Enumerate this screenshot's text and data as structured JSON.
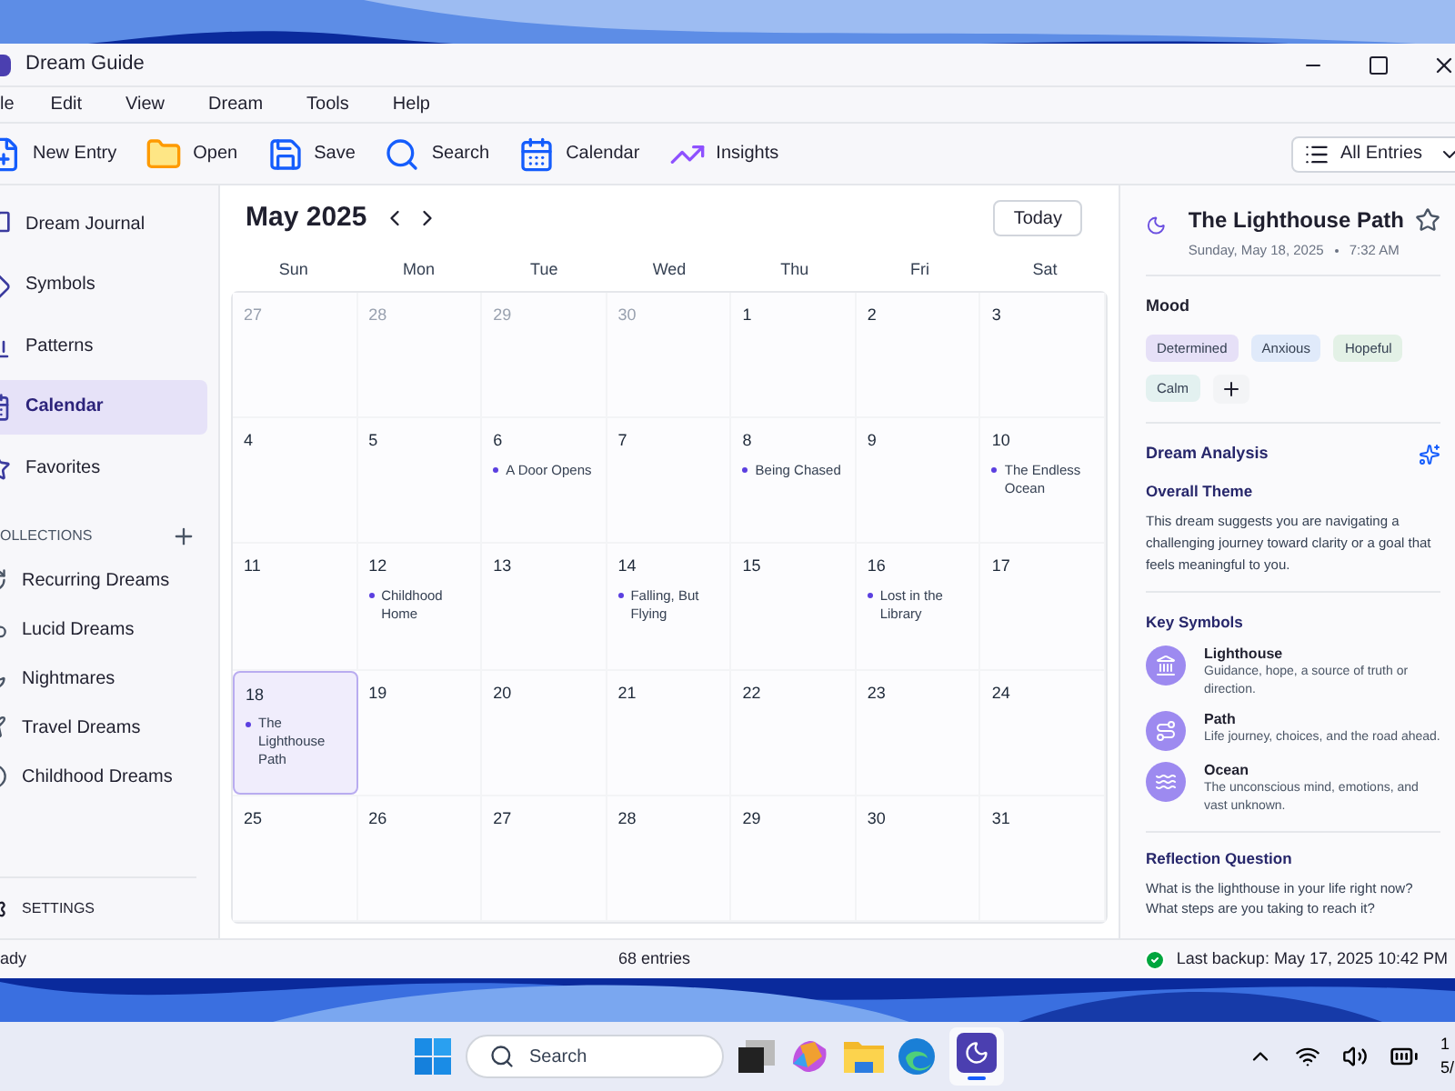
{
  "window": {
    "title": "Dream Guide"
  },
  "menu": [
    "le",
    "Edit",
    "View",
    "Dream",
    "Tools",
    "Help"
  ],
  "toolbar": [
    "New Entry",
    "Open",
    "Save",
    "Search",
    "Calendar",
    "Insights"
  ],
  "filter": {
    "value": "All Entries"
  },
  "sidebar": {
    "items": [
      {
        "label": "Dream Journal",
        "selected": false
      },
      {
        "label": "Symbols",
        "selected": false
      },
      {
        "label": "Patterns",
        "selected": false
      },
      {
        "label": "Calendar",
        "selected": true
      },
      {
        "label": "Favorites",
        "selected": false
      }
    ],
    "collections_heading": "OLLECTIONS",
    "collections": [
      "Recurring Dreams",
      "Lucid Dreams",
      "Nightmares",
      "Travel Dreams",
      "Childhood Dreams"
    ],
    "settings": "SETTINGS"
  },
  "calendar": {
    "title": "May 2025",
    "today_button": "Today",
    "weekdays": [
      "Sun",
      "Mon",
      "Tue",
      "Wed",
      "Thu",
      "Fri",
      "Sat"
    ],
    "weeks": [
      [
        {
          "day": "27",
          "outside_month": true,
          "selected": false
        },
        {
          "day": "28",
          "outside_month": true,
          "selected": false
        },
        {
          "day": "29",
          "outside_month": true,
          "selected": false
        },
        {
          "day": "30",
          "outside_month": true,
          "selected": false
        },
        {
          "day": "1",
          "outside_month": false,
          "selected": false
        },
        {
          "day": "2",
          "outside_month": false,
          "selected": false
        },
        {
          "day": "3",
          "outside_month": false,
          "selected": false
        }
      ],
      [
        {
          "day": "4",
          "outside_month": false,
          "selected": false
        },
        {
          "day": "5",
          "outside_month": false,
          "selected": false
        },
        {
          "day": "6",
          "outside_month": false,
          "selected": false,
          "entries": [
            "A Door Opens"
          ]
        },
        {
          "day": "7",
          "outside_month": false,
          "selected": false
        },
        {
          "day": "8",
          "outside_month": false,
          "selected": false,
          "entries": [
            "Being Chased"
          ]
        },
        {
          "day": "9",
          "outside_month": false,
          "selected": false
        },
        {
          "day": "10",
          "outside_month": false,
          "selected": false,
          "entries": [
            "The Endless Ocean"
          ]
        }
      ],
      [
        {
          "day": "11",
          "outside_month": false,
          "selected": false
        },
        {
          "day": "12",
          "outside_month": false,
          "selected": false,
          "entries": [
            "Childhood Home"
          ]
        },
        {
          "day": "13",
          "outside_month": false,
          "selected": false
        },
        {
          "day": "14",
          "outside_month": false,
          "selected": false,
          "entries": [
            "Falling, But Flying"
          ]
        },
        {
          "day": "15",
          "outside_month": false,
          "selected": false
        },
        {
          "day": "16",
          "outside_month": false,
          "selected": false,
          "entries": [
            "Lost in the Library"
          ]
        },
        {
          "day": "17",
          "outside_month": false,
          "selected": false
        }
      ],
      [
        {
          "day": "18",
          "outside_month": false,
          "selected": true,
          "entries": [
            "The Lighthouse Path"
          ]
        },
        {
          "day": "19",
          "outside_month": false,
          "selected": false
        },
        {
          "day": "20",
          "outside_month": false,
          "selected": false
        },
        {
          "day": "21",
          "outside_month": false,
          "selected": false
        },
        {
          "day": "22",
          "outside_month": false,
          "selected": false
        },
        {
          "day": "23",
          "outside_month": false,
          "selected": false
        },
        {
          "day": "24",
          "outside_month": false,
          "selected": false
        }
      ],
      [
        {
          "day": "25",
          "outside_month": false,
          "selected": false
        },
        {
          "day": "26",
          "outside_month": false,
          "selected": false
        },
        {
          "day": "27",
          "outside_month": false,
          "selected": false
        },
        {
          "day": "28",
          "outside_month": false,
          "selected": false
        },
        {
          "day": "29",
          "outside_month": false,
          "selected": false
        },
        {
          "day": "30",
          "outside_month": false,
          "selected": false
        },
        {
          "day": "31",
          "outside_month": false,
          "selected": false
        }
      ]
    ]
  },
  "detail": {
    "title": "The Lighthouse Path",
    "favorite": false,
    "date": "Sunday, May 18, 2025",
    "time": "7:32 AM",
    "mood_heading": "Mood",
    "moods": [
      {
        "label": "Determined",
        "color": "#e6e0f7"
      },
      {
        "label": "Anxious",
        "color": "#e0eafa"
      },
      {
        "label": "Hopeful",
        "color": "#e3f1e6"
      },
      {
        "label": "Calm",
        "color": "#e3f1f0"
      }
    ],
    "analysis_heading": "Dream Analysis",
    "theme_heading": "Overall Theme",
    "theme_text": "This dream suggests you are navigating a challenging journey toward clarity or a goal that feels meaningful to you.",
    "symbols_heading": "Key Symbols",
    "symbols": [
      {
        "name": "Lighthouse",
        "text": "Guidance, hope, a source of truth or direction."
      },
      {
        "name": "Path",
        "text": "Life journey, choices, and the road ahead."
      },
      {
        "name": "Ocean",
        "text": "The unconscious mind, emotions, and vast unknown."
      }
    ],
    "reflection_heading": "Reflection Question",
    "reflection_text": "What is the lighthouse in your life right now? What steps are you taking to reach it?"
  },
  "status_bar": {
    "left": "ady",
    "center": "68 entries",
    "right": "Last backup: May 17, 2025 10:42 PM"
  },
  "taskbar": {
    "search_placeholder": "Search",
    "clock": [
      "1",
      "5/"
    ]
  }
}
